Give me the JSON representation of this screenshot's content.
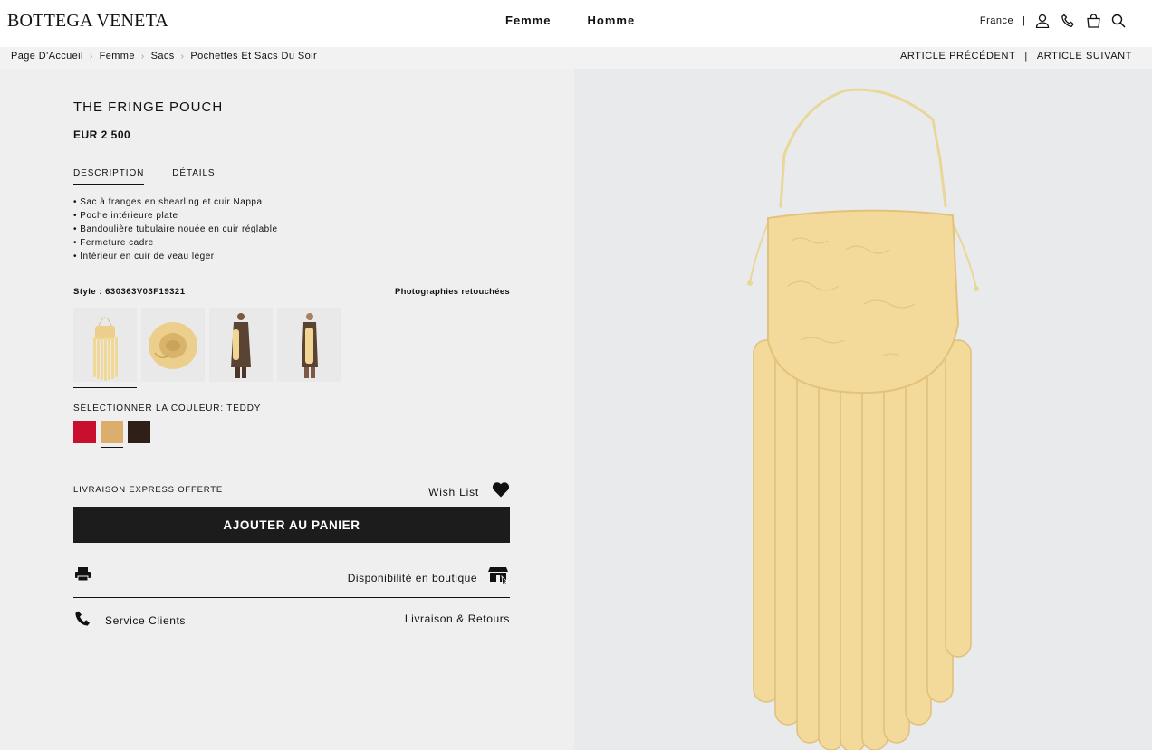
{
  "header": {
    "logo": "BOTTEGA VENETA",
    "nav": [
      "Femme",
      "Homme"
    ],
    "country": "France",
    "separator": "|",
    "icons": [
      "account-icon",
      "phone-icon",
      "bag-icon",
      "search-icon"
    ]
  },
  "breadcrumb": {
    "items": [
      "Page D'Accueil",
      "Femme",
      "Sacs",
      "Pochettes Et Sacs Du Soir"
    ],
    "chevron": "›"
  },
  "article_nav": {
    "previous": "ARTICLE PRÉCÉDENT",
    "separator": "|",
    "next": "ARTICLE SUIVANT"
  },
  "product": {
    "title": "THE FRINGE POUCH",
    "price": "EUR 2 500",
    "tabs": [
      "DESCRIPTION",
      "DÉTAILS"
    ],
    "active_tab": "DESCRIPTION",
    "description": [
      "• Sac à franges en shearling et cuir Nappa",
      "• Poche intérieure plate",
      "• Bandoulière tubulaire nouée en cuir réglable",
      "• Fermeture cadre",
      "• Intérieur en cuir de veau léger"
    ],
    "style": "Style : 630363V03F19321",
    "retouched": "Photographies retouchées",
    "color_label": "SÉLECTIONNER LA COULEUR: TEDDY",
    "swatches": [
      {
        "color": "#c8102e"
      },
      {
        "color": "#dcae6c",
        "selected": true
      },
      {
        "color": "#2e2019"
      }
    ]
  },
  "actions": {
    "express": "LIVRAISON EXPRESS OFFERTE",
    "wishlist": "Wish List",
    "add_to_cart": "AJOUTER AU PANIER",
    "availability": "Disponibilité en boutique",
    "service": "Service Clients",
    "delivery": "Livraison & Retours"
  },
  "colors": {
    "bag": "#f3d99a",
    "bag_shadow": "#e2c27c",
    "strap": "#e9d79a",
    "panel_bg": "#efefef",
    "image_bg": "#e9eaec",
    "button": "#1c1c1c"
  }
}
